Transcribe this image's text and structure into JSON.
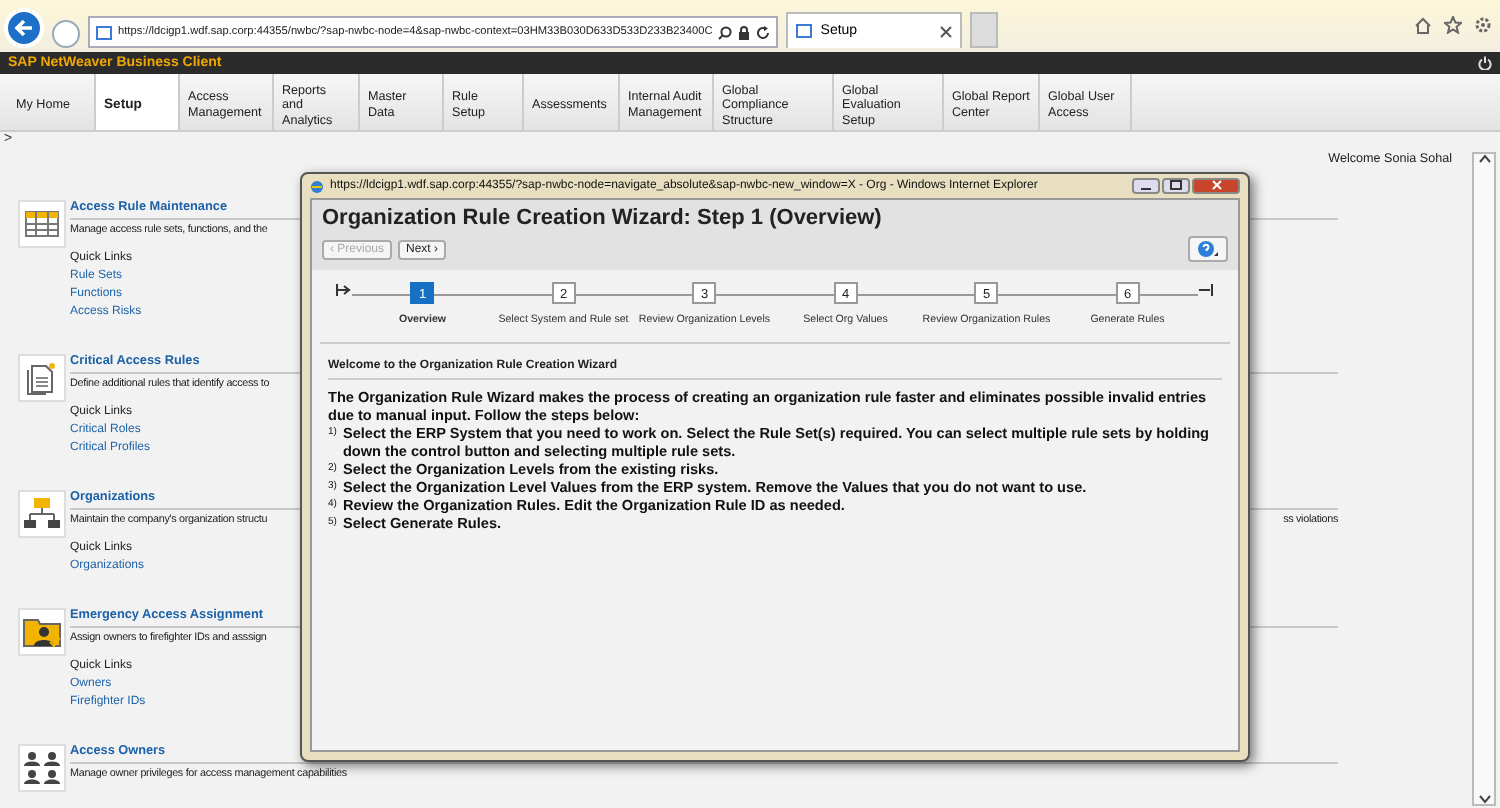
{
  "browser": {
    "address": "https://ldcigp1.wdf.sap.corp:44355/nwbc/?sap-nwbc-node=4&sap-nwbc-context=03HM33B030D633D533D233B23400C",
    "tab": "Setup"
  },
  "app_bar": {
    "title": "SAP NetWeaver Business Client"
  },
  "nav_tabs": [
    {
      "label": "My Home",
      "selected": false
    },
    {
      "label": "Setup",
      "selected": true
    },
    {
      "label": "Access Management",
      "selected": false
    },
    {
      "label": "Reports and Analytics",
      "selected": false
    },
    {
      "label": "Master Data",
      "selected": false
    },
    {
      "label": "Rule Setup",
      "selected": false
    },
    {
      "label": "Assessments",
      "selected": false
    },
    {
      "label": "Internal Audit Management",
      "selected": false
    },
    {
      "label": "Global Compliance Structure",
      "selected": false
    },
    {
      "label": "Global Evaluation Setup",
      "selected": false
    },
    {
      "label": "Global Report Center",
      "selected": false
    },
    {
      "label": "Global User Access",
      "selected": false
    }
  ],
  "collapse_marker": ">",
  "welcome": "Welcome Sonia Sohal",
  "sections": [
    {
      "kind": "table",
      "title": "Access Rule Maintenance",
      "description": "Manage access rule sets, functions, and the",
      "quick_links_label": "Quick Links",
      "links": [
        "Rule Sets",
        "Functions",
        "Access Risks"
      ]
    },
    {
      "kind": "document",
      "title": "Critical Access Rules",
      "description": "Define additional rules that identify access to",
      "quick_links_label": "Quick Links",
      "links": [
        "Critical Roles",
        "Critical Profiles"
      ]
    },
    {
      "kind": "hierarchy",
      "title": "Organizations",
      "description": "Maintain the company's organization structu",
      "description_end": "ss violations",
      "quick_links_label": "Quick Links",
      "links": [
        "Organizations"
      ]
    },
    {
      "kind": "folder",
      "title": "Emergency Access Assignment",
      "description": "Assign owners to firefighter IDs and asssign",
      "quick_links_label": "Quick Links",
      "links": [
        "Owners",
        "Firefighter IDs"
      ]
    },
    {
      "kind": "people",
      "title": "Access Owners",
      "description": "Manage owner privileges for access management capabilities"
    }
  ],
  "popup": {
    "address": "https://ldcigp1.wdf.sap.corp:44355/?sap-nwbc-node=navigate_absolute&sap-nwbc-new_window=X - Org - Windows Internet Explorer",
    "heading": "Organization Rule Creation Wizard: Step 1  (Overview)",
    "buttons": [
      {
        "label": "‹ Previous",
        "disabled": true
      },
      {
        "label": "Next ›",
        "disabled": false
      }
    ],
    "steps": [
      {
        "number": "1",
        "label": "Overview",
        "selected": true
      },
      {
        "number": "2",
        "label": "Select System and Rule set",
        "selected": false
      },
      {
        "number": "3",
        "label": "Review Organization Levels",
        "selected": false
      },
      {
        "number": "4",
        "label": "Select Org Values",
        "selected": false
      },
      {
        "number": "5",
        "label": "Review Organization Rules",
        "selected": false
      },
      {
        "number": "6",
        "label": "Generate Rules",
        "selected": false
      }
    ],
    "welcome_heading": "Welcome to the Organization Rule Creation Wizard",
    "intro": "The Organization Rule Wizard makes the process of creating an organization rule faster and eliminates possible invalid entries due to manual input. Follow the steps below:",
    "instructions": [
      {
        "number": "1)",
        "text": "Select the ERP System that you need to work on. Select the Rule Set(s) required. You can select multiple rule sets by holding down the control button and selecting multiple rule sets."
      },
      {
        "number": "2)",
        "text": "Select the Organization Levels from the existing risks."
      },
      {
        "number": "3)",
        "text": "Select the Organization Level Values from the ERP system. Remove the Values that you do not want to use."
      },
      {
        "number": "4)",
        "text": "Review the Organization Rules. Edit the Organization Rule ID as needed."
      },
      {
        "number": "5)",
        "text": "Select Generate Rules."
      }
    ]
  }
}
